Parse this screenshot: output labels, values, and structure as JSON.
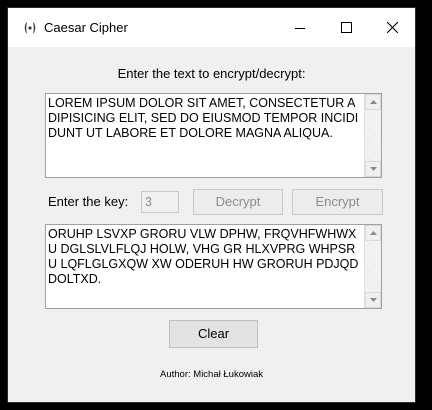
{
  "window": {
    "title": "Caesar Cipher",
    "icon": "tk-feather-icon",
    "controls": [
      "minimize-icon",
      "maximize-icon",
      "close-icon"
    ]
  },
  "main": {
    "prompt": "Enter the text to encrypt/decrypt:",
    "input_text": "LOREM IPSUM DOLOR SIT AMET, CONSECTETUR ADIPISICING ELIT, SED DO EIUSMOD TEMPOR INCIDIDUNT UT LABORE ET DOLORE MAGNA ALIQUA.",
    "key_label": "Enter the key:",
    "key_value": "3",
    "decrypt_label": "Decrypt",
    "encrypt_label": "Encrypt",
    "output_text": "ORUHP LSVXP GRORU VLW DPHW, FRQVHFWHWXU DGLSLVLFLQJ HOLW, VHG GR HLXVPRG WHPSRU LQFLGLGXQW XW ODERUH HW GRORUH PDJQD DOLTXD.",
    "clear_label": "Clear",
    "author": "Author: Michał Łukowiak"
  }
}
